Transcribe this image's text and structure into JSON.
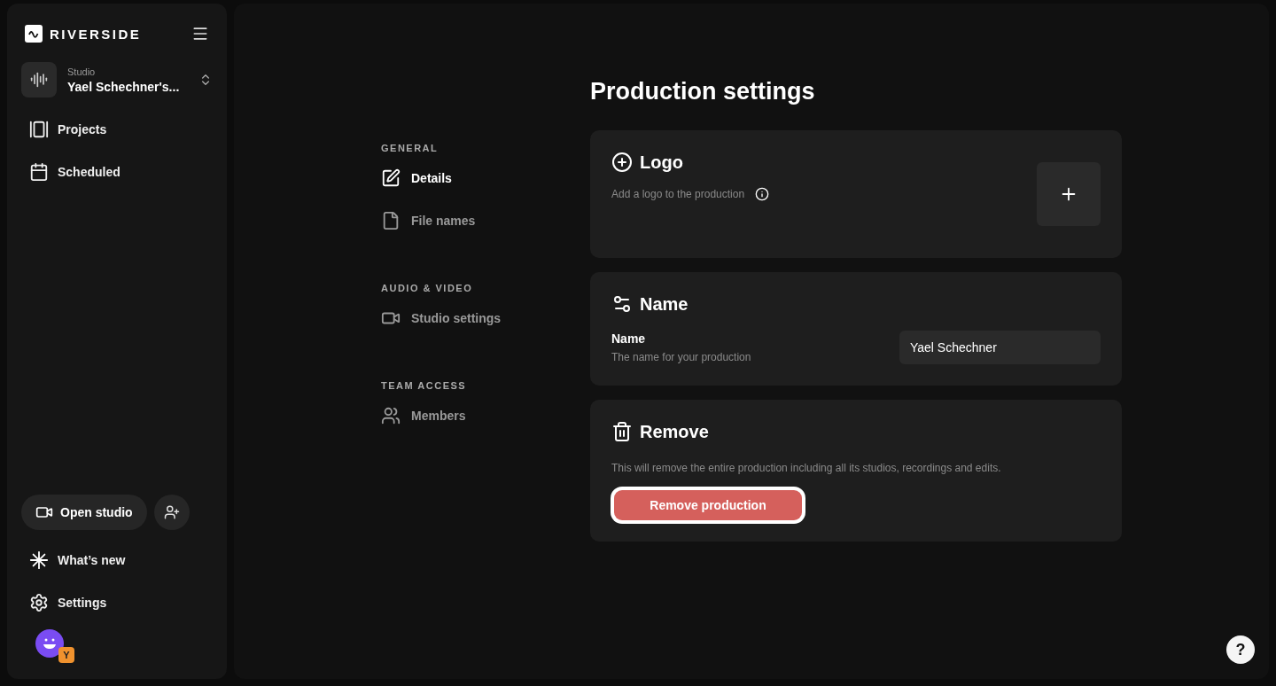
{
  "sidebar": {
    "brand": "RIVERSIDE",
    "studio": {
      "label": "Studio",
      "name": "Yael Schechner's..."
    },
    "items": [
      {
        "kind": "projects",
        "label": "Projects"
      },
      {
        "kind": "calendar",
        "label": "Scheduled"
      }
    ],
    "open_studio": "Open studio",
    "bottom_items": [
      {
        "kind": "sparkle",
        "label": "What’s new"
      },
      {
        "kind": "gear",
        "label": "Settings"
      }
    ],
    "avatar_badge": "Y"
  },
  "page": {
    "title": "Production settings",
    "nav": [
      {
        "heading": "GENERAL",
        "items": [
          {
            "kind": "edit",
            "label": "Details",
            "selected": true
          },
          {
            "kind": "file",
            "label": "File names",
            "selected": false
          }
        ]
      },
      {
        "heading": "AUDIO & VIDEO",
        "items": [
          {
            "kind": "video",
            "label": "Studio settings",
            "selected": false
          }
        ]
      },
      {
        "heading": "TEAM ACCESS",
        "items": [
          {
            "kind": "users",
            "label": "Members",
            "selected": false
          }
        ]
      }
    ],
    "logo": {
      "title": "Logo",
      "description": "Add a logo to the production"
    },
    "name": {
      "title": "Name",
      "field_label": "Name",
      "field_hint": "The name for your production",
      "value": "Yael Schechner"
    },
    "remove": {
      "title": "Remove",
      "description": "This will remove the entire production including all its studios, recordings and edits.",
      "button": "Remove production",
      "focused": true
    }
  },
  "help": "?"
}
